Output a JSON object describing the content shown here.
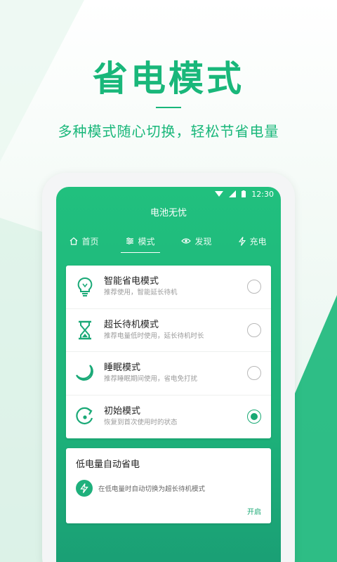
{
  "promo": {
    "title": "省电模式",
    "subtitle": "多种模式随心切换，轻松节省电量"
  },
  "status_bar": {
    "time": "12:30"
  },
  "app": {
    "title": "电池无忧"
  },
  "tabs": [
    {
      "label": "首页",
      "icon": "home-icon",
      "active": false
    },
    {
      "label": "模式",
      "icon": "sliders-icon",
      "active": true
    },
    {
      "label": "发现",
      "icon": "eye-icon",
      "active": false
    },
    {
      "label": "充电",
      "icon": "bolt-icon",
      "active": false
    }
  ],
  "modes": [
    {
      "name": "智能省电模式",
      "desc": "推荐使用，智能延长待机",
      "icon": "lightbulb-icon",
      "selected": false
    },
    {
      "name": "超长待机模式",
      "desc": "推荐电量低时使用，延长待机时长",
      "icon": "hourglass-icon",
      "selected": false
    },
    {
      "name": "睡眠模式",
      "desc": "推荐睡眠期间使用，省电免打扰",
      "icon": "moon-icon",
      "selected": false
    },
    {
      "name": "初始模式",
      "desc": "恢复到首次使用时的状态",
      "icon": "reset-icon",
      "selected": true
    }
  ],
  "auto_save": {
    "title": "低电量自动省电",
    "desc": "在低电量时自动切换为超长待机模式",
    "action": "开启",
    "icon": "bolt-icon"
  },
  "colors": {
    "accent": "#19b77a",
    "screen_top": "#21c07e",
    "screen_bottom": "#1a9d74"
  }
}
